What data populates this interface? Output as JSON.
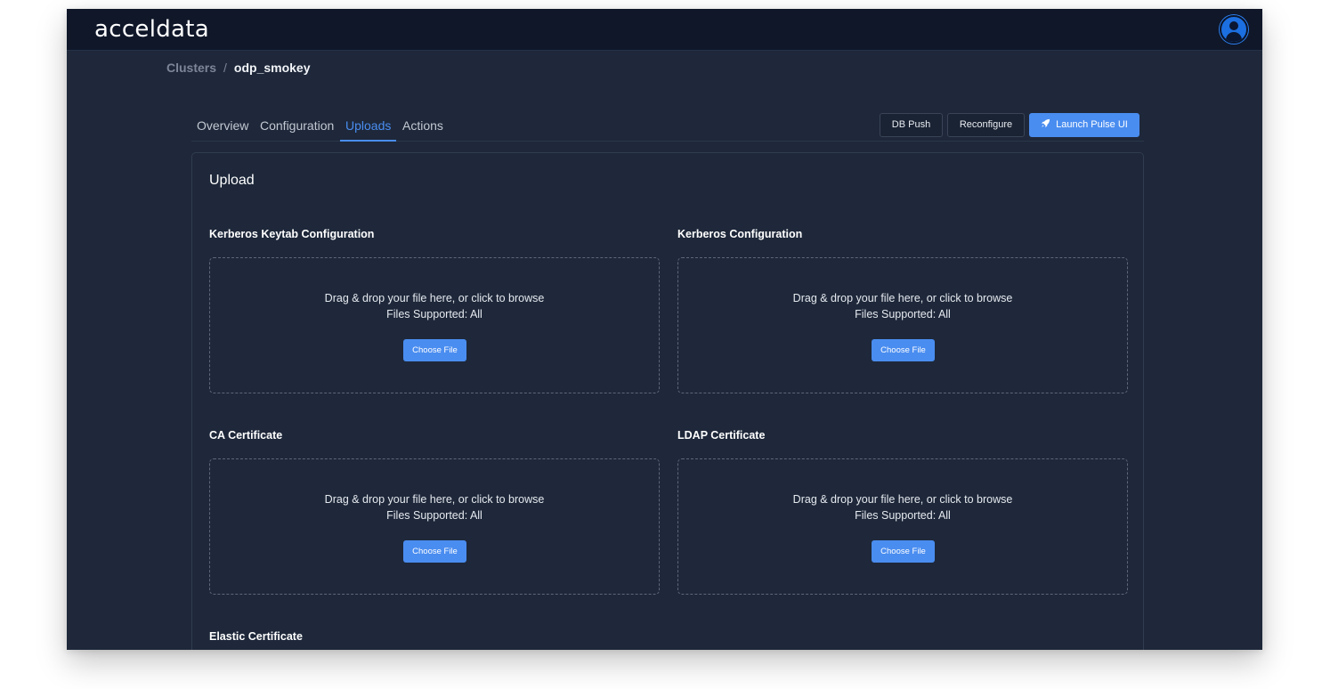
{
  "app": {
    "logo_text": "acceldata"
  },
  "header": {
    "avatar_icon": "user-avatar-icon"
  },
  "breadcrumb": {
    "parent": "Clusters",
    "separator": "/",
    "current": "odp_smokey"
  },
  "tabs": [
    {
      "label": "Overview",
      "active": false
    },
    {
      "label": "Configuration",
      "active": false
    },
    {
      "label": "Uploads",
      "active": true
    },
    {
      "label": "Actions",
      "active": false
    }
  ],
  "actions": {
    "db_push": "DB Push",
    "reconfigure": "Reconfigure",
    "launch": "Launch Pulse UI",
    "launch_icon": "rocket-icon"
  },
  "upload": {
    "title": "Upload",
    "dropzone_text": "Drag & drop your file here, or click to browse",
    "supported_text": "Files Supported: All",
    "choose_label": "Choose File",
    "sections": [
      {
        "title": "Kerberos Keytab Configuration"
      },
      {
        "title": "Kerberos Configuration"
      },
      {
        "title": "CA Certificate"
      },
      {
        "title": "LDAP Certificate"
      },
      {
        "title": "Elastic Certificate"
      }
    ]
  },
  "colors": {
    "background": "#1e283a",
    "topbar": "#0f1729",
    "accent": "#4a8df0",
    "avatar": "#1c6fe0"
  }
}
